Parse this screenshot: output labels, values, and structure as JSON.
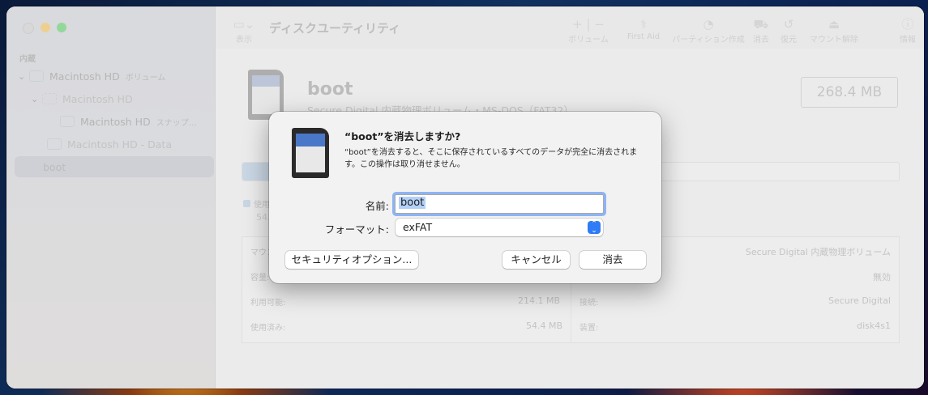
{
  "window": {
    "title": "ディスクユーティリティ"
  },
  "sidebar": {
    "section": "内蔵",
    "items": [
      {
        "label": "Macintosh HD",
        "sub": "ボリューム"
      },
      {
        "label": "Macintosh HD"
      },
      {
        "label": "Macintosh HD",
        "sub": "スナップ…"
      },
      {
        "label": "Macintosh HD - Data"
      },
      {
        "label": "boot"
      }
    ]
  },
  "toolbar": {
    "view_label": "表示",
    "volume_label": "ボリューム",
    "firstaid_label": "First Aid",
    "partition_label": "パーティション作成",
    "erase_label": "消去",
    "restore_label": "復元",
    "unmount_label": "マウント解除",
    "info_label": "情報"
  },
  "volume": {
    "name": "boot",
    "subtitle": "Secure Digital 内蔵物理ボリューム・MS-DOS（FAT32）",
    "size": "268.4 MB",
    "used_legend": "使用",
    "used_short": "54.",
    "details": {
      "mount_label": "マウン",
      "capacity_label": "容量:",
      "available_label": "利用可能:",
      "available_value": "214.1 MB",
      "used_label": "使用済み:",
      "used_value": "54.4 MB",
      "type_value": "Secure Digital 内蔵物理ボリューム",
      "owners_value": "無効",
      "connection_label": "接続:",
      "connection_value": "Secure Digital",
      "device_label": "装置:",
      "device_value": "disk4s1"
    }
  },
  "dialog": {
    "title": "“boot”を消去しますか?",
    "message": "“boot”を消去すると、そこに保存されているすべてのデータが完全に消去されます。この操作は取り消せません。",
    "name_label": "名前:",
    "name_value": "boot",
    "format_label": "フォーマット:",
    "format_value": "exFAT",
    "security_button": "セキュリティオプション...",
    "cancel_button": "キャンセル",
    "erase_button": "消去"
  }
}
